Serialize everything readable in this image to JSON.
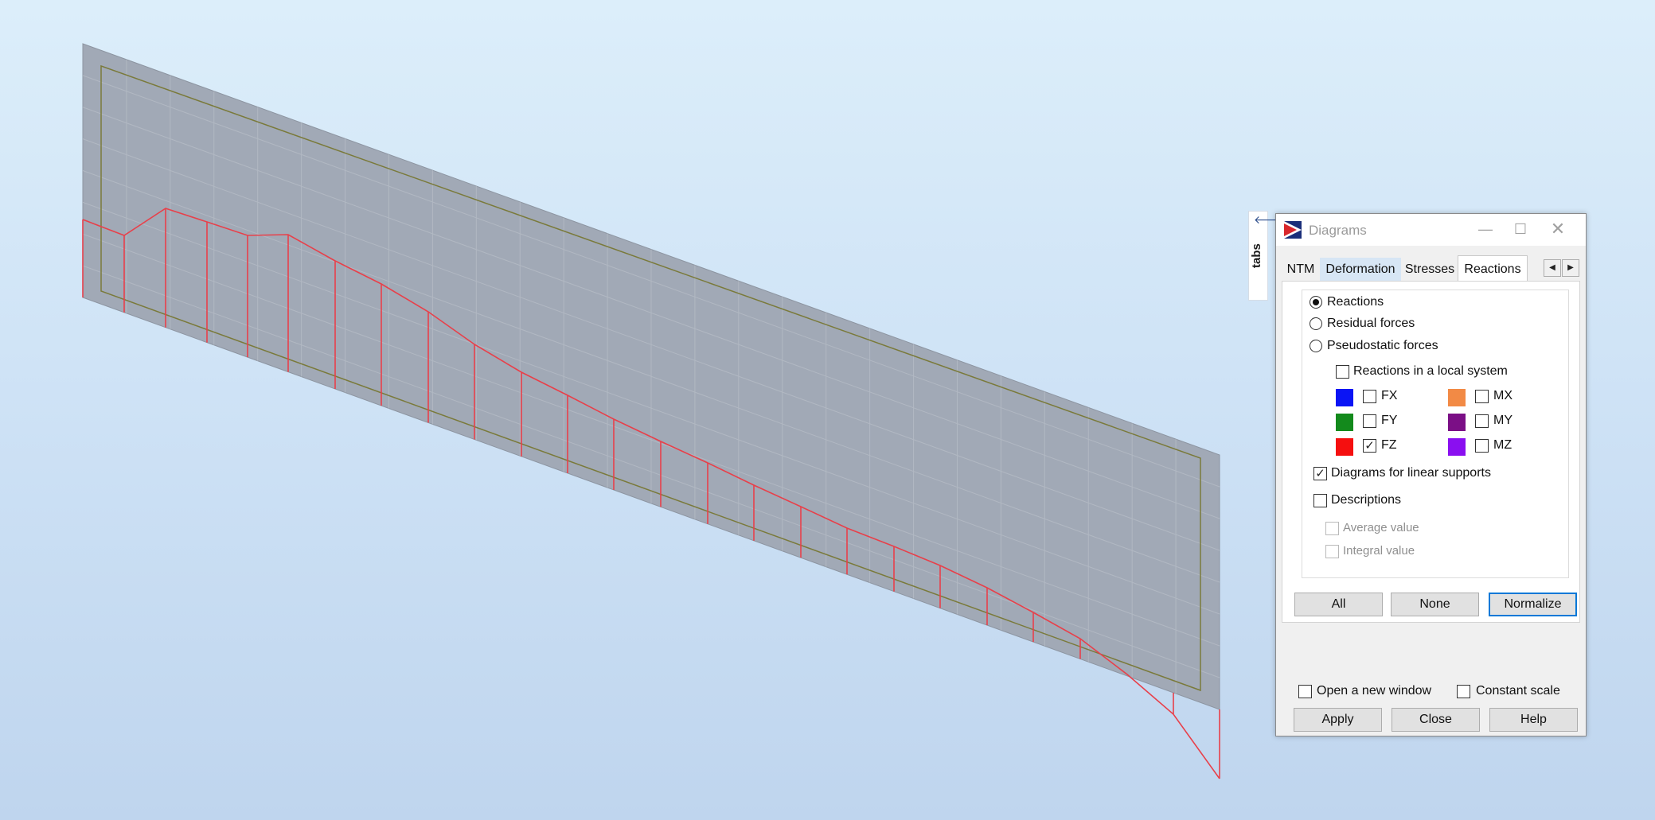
{
  "side_tab": {
    "label": "tabs"
  },
  "dialog": {
    "title": "Diagrams",
    "tabs": [
      "NTM",
      "Deformation",
      "Stresses",
      "Reactions"
    ],
    "active_tab": "Reactions",
    "options": {
      "reactions": "Reactions",
      "residual_forces": "Residual forces",
      "pseudostatic_forces": "Pseudostatic forces",
      "selected": "Reactions"
    },
    "local_system": {
      "label": "Reactions in a local system",
      "checked": false
    },
    "components": [
      {
        "label": "FX",
        "color": "#0a14f5",
        "checked": false
      },
      {
        "label": "FY",
        "color": "#138a1c",
        "checked": false
      },
      {
        "label": "FZ",
        "color": "#f50f0f",
        "checked": true
      },
      {
        "label": "MX",
        "color": "#f28a45",
        "checked": false
      },
      {
        "label": "MY",
        "color": "#7b0f86",
        "checked": false
      },
      {
        "label": "MZ",
        "color": "#8a0ff0",
        "checked": false
      }
    ],
    "linear_supports": {
      "label": "Diagrams for linear supports",
      "checked": true
    },
    "descriptions": {
      "label": "Descriptions",
      "checked": false
    },
    "average_value": {
      "label": "Average value",
      "enabled": false
    },
    "integral_value": {
      "label": "Integral value",
      "enabled": false
    },
    "buttons": {
      "all": "All",
      "none": "None",
      "normalize": "Normalize"
    },
    "open_new_window": {
      "label": "Open a new window",
      "checked": false
    },
    "constant_scale": {
      "label": "Constant scale",
      "checked": false
    },
    "footer_buttons": {
      "apply": "Apply",
      "close": "Close",
      "help": "Help"
    }
  },
  "colors": {
    "plate": "#a1a9b6",
    "diagram": "#e8404a",
    "outline": "#7a7a3a"
  }
}
